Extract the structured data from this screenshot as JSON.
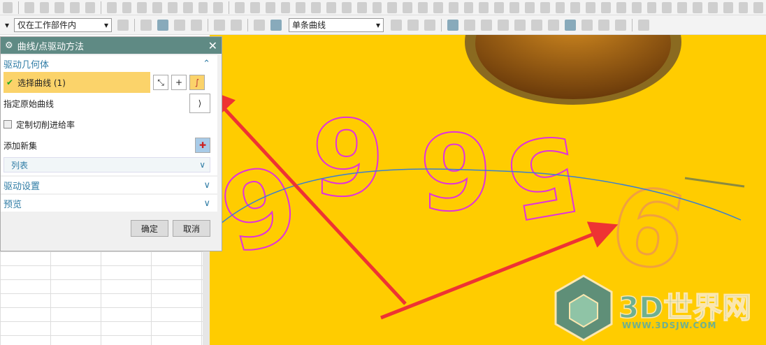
{
  "toolbar": {
    "filter_value": "仅在工作部件内",
    "curve_rule": "单条曲线"
  },
  "dialog": {
    "title": "曲线/点驱动方法",
    "sections": {
      "drive_geometry": "驱动几何体",
      "drive_settings": "驱动设置",
      "preview": "预览"
    },
    "select_curve": "选择曲线 (1)",
    "specify_original_curve": "指定原始曲线",
    "custom_feedrate": "定制切削进给率",
    "add_new_set": "添加新集",
    "list": "列表",
    "ok": "确定",
    "cancel": "取消"
  },
  "viewport": {
    "digits": [
      "9",
      "6",
      "9",
      "5",
      "6"
    ],
    "background_color": "#ffcc00",
    "curve_color": "#3a7fd0",
    "outline_color": "#e030e0",
    "arrow_color": "#ee3333"
  },
  "watermark": {
    "name": "3D世界网",
    "url": "WWW.3DSJW.COM"
  }
}
